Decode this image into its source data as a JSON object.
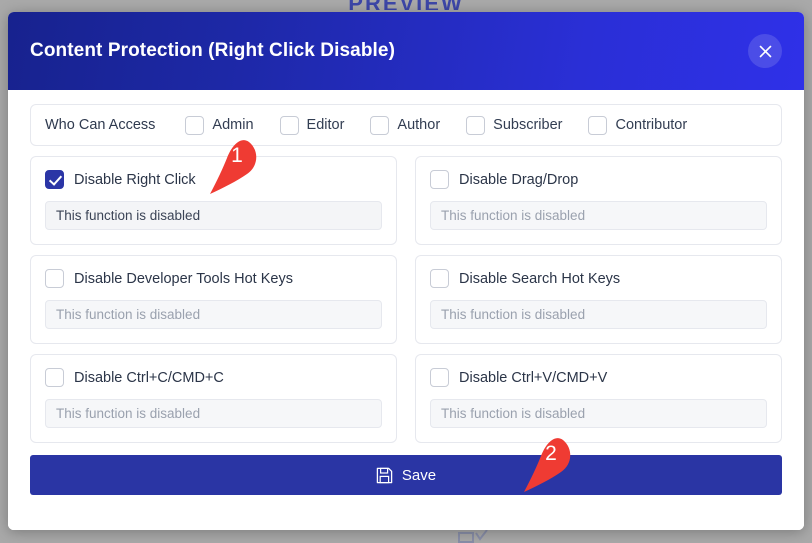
{
  "background": {
    "top_text": "PREVIEW"
  },
  "modal": {
    "title": "Content Protection (Right Click Disable)",
    "close_icon": "close-icon",
    "access": {
      "label": "Who Can Access",
      "roles": [
        {
          "label": "Admin",
          "checked": false
        },
        {
          "label": "Editor",
          "checked": false
        },
        {
          "label": "Author",
          "checked": false
        },
        {
          "label": "Subscriber",
          "checked": false
        },
        {
          "label": "Contributor",
          "checked": false
        }
      ]
    },
    "features": [
      {
        "title": "Disable Right Click",
        "checked": true,
        "value": "This function is disabled",
        "placeholder": "This function is disabled"
      },
      {
        "title": "Disable Drag/Drop",
        "checked": false,
        "value": "",
        "placeholder": "This function is disabled"
      },
      {
        "title": "Disable Developer Tools Hot Keys",
        "checked": false,
        "value": "",
        "placeholder": "This function is disabled"
      },
      {
        "title": "Disable Search Hot Keys",
        "checked": false,
        "value": "",
        "placeholder": "This function is disabled"
      },
      {
        "title": "Disable Ctrl+C/CMD+C",
        "checked": false,
        "value": "",
        "placeholder": "This function is disabled"
      },
      {
        "title": "Disable Ctrl+V/CMD+V",
        "checked": false,
        "value": "",
        "placeholder": "This function is disabled"
      },
      {
        "title": "",
        "checked": false,
        "value": "",
        "placeholder": ""
      },
      {
        "title": "",
        "checked": false,
        "value": "",
        "placeholder": ""
      }
    ],
    "footer": {
      "save_label": "Save",
      "save_icon": "save-floppy-icon"
    }
  },
  "annotations": [
    {
      "number": "1"
    },
    {
      "number": "2"
    }
  ],
  "colors": {
    "header_gradient_start": "#17228e",
    "header_gradient_end": "#2f30e8",
    "accent": "#2b35a6",
    "save_button": "#2a35a4",
    "annotation_red": "#ef3b33",
    "card_border": "#e6e8ee",
    "input_fill": "#f4f5f7"
  }
}
